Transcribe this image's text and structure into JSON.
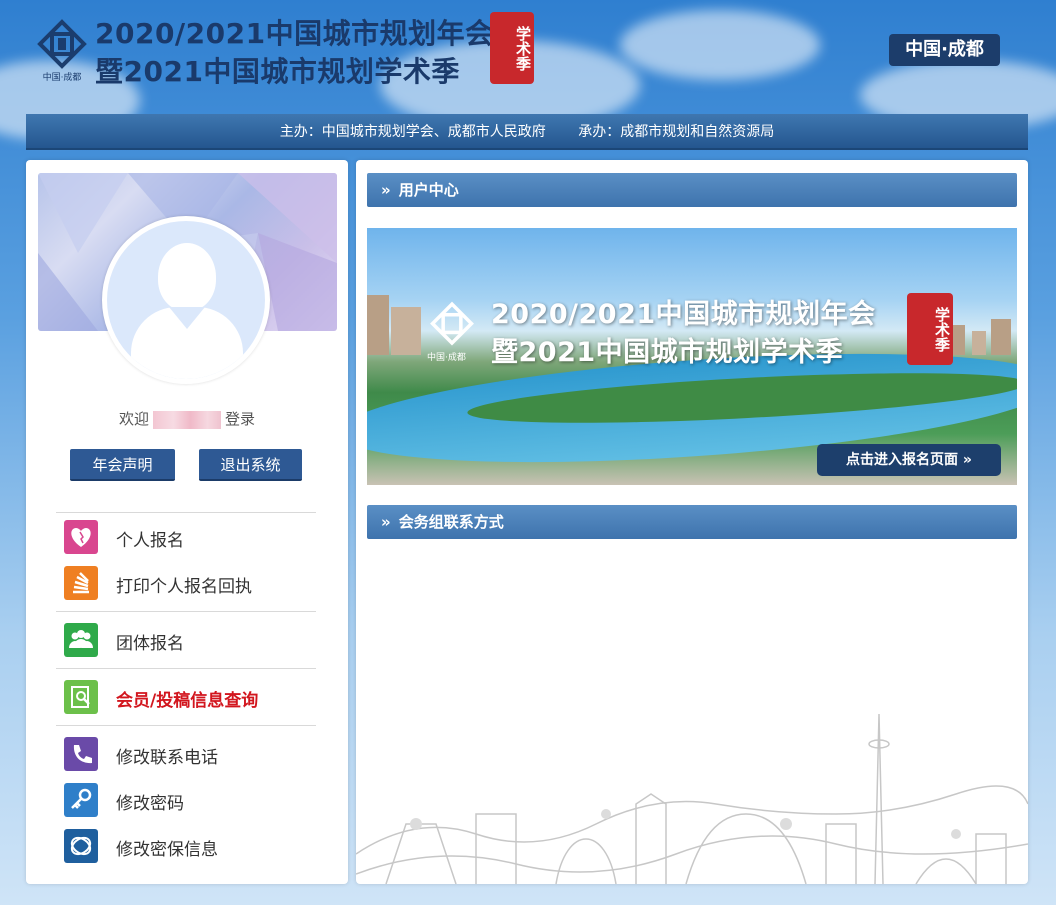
{
  "header": {
    "logo_caption": "中国·成都",
    "title_line1": "2020/2021中国城市规划年会",
    "title_line2": "暨2021中国城市规划学术季",
    "seal_text": "学术季",
    "city_tag": "中国·成都"
  },
  "org_bar": {
    "host": "主办：中国城市规划学会、成都市人民政府",
    "organizer": "承办：成都市规划和自然资源局"
  },
  "profile": {
    "welcome_prefix": "欢迎",
    "welcome_suffix": "登录",
    "buttons": {
      "statement": "年会声明",
      "logout": "退出系统"
    }
  },
  "menu": {
    "items": [
      {
        "label": "个人报名",
        "icon": "heart-icon",
        "color": "#d9468f"
      },
      {
        "label": "打印个人报名回执",
        "icon": "stack-icon",
        "color": "#ef7f22"
      },
      {
        "label": "团体报名",
        "icon": "group-icon",
        "color": "#2faa4a"
      },
      {
        "label": "会员/投稿信息查询",
        "icon": "search-doc-icon",
        "color": "#6cc04a",
        "highlight": "#d2161e"
      },
      {
        "label": "修改联系电话",
        "icon": "phone-icon",
        "color": "#6a4aa8"
      },
      {
        "label": "修改密码",
        "icon": "key-icon",
        "color": "#2f7fc9"
      },
      {
        "label": "修改密保信息",
        "icon": "shield-icon",
        "color": "#1f5f9e"
      }
    ]
  },
  "main": {
    "section_user_center": "用户中心",
    "banner": {
      "logo_caption": "中国·成都",
      "title_line1": "2020/2021中国城市规划年会",
      "title_line2": "暨2021中国城市规划学术季",
      "seal_text": "学术季",
      "cta": "点击进入报名页面"
    },
    "section_contact": "会务组联系方式"
  },
  "colors": {
    "brand_dark": "#1c3d6b",
    "section_bar": "#4a80ba",
    "highlight_red": "#d2161e"
  }
}
